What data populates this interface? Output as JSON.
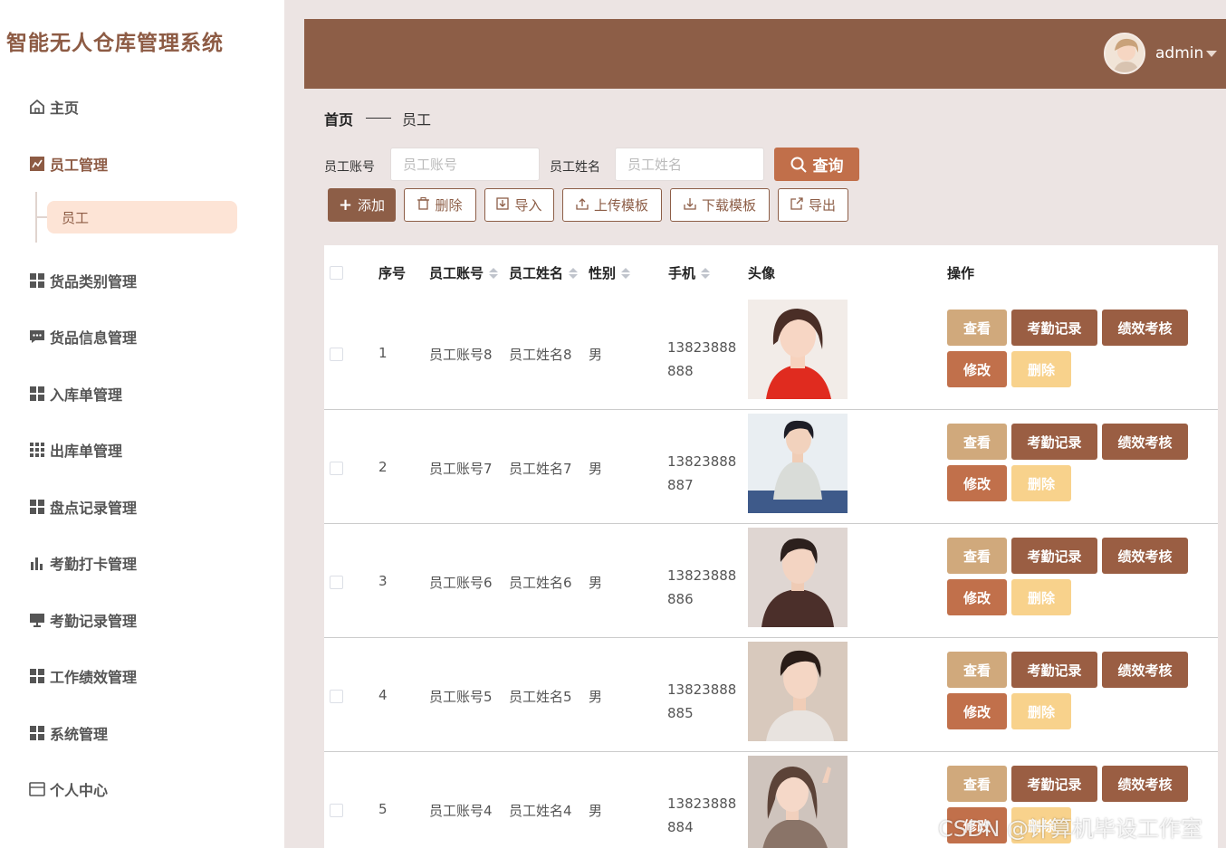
{
  "app": {
    "title": "智能无人仓库管理系统"
  },
  "sidebar": {
    "items": [
      {
        "label": "主页",
        "icon": "home-icon"
      },
      {
        "label": "员工管理",
        "icon": "chart-icon"
      },
      {
        "label": "货品类别管理",
        "icon": "grid-icon"
      },
      {
        "label": "货品信息管理",
        "icon": "message-icon"
      },
      {
        "label": "入库单管理",
        "icon": "grid-icon"
      },
      {
        "label": "出库单管理",
        "icon": "grid9-icon"
      },
      {
        "label": "盘点记录管理",
        "icon": "grid-icon"
      },
      {
        "label": "考勤打卡管理",
        "icon": "bar-chart-icon"
      },
      {
        "label": "考勤记录管理",
        "icon": "monitor-icon"
      },
      {
        "label": "工作绩效管理",
        "icon": "grid-icon"
      },
      {
        "label": "系统管理",
        "icon": "grid-icon"
      },
      {
        "label": "个人中心",
        "icon": "card-icon"
      }
    ],
    "sub_items": [
      {
        "label": "员工"
      }
    ]
  },
  "header": {
    "username": "admin"
  },
  "breadcrumb": {
    "home": "首页",
    "current": "员工"
  },
  "search": {
    "account_label": "员工账号",
    "account_placeholder": "员工账号",
    "name_label": "员工姓名",
    "name_placeholder": "员工姓名",
    "query_label": "查询"
  },
  "toolbar": {
    "add": "添加",
    "delete": "删除",
    "import": "导入",
    "upload_template": "上传模板",
    "download_template": "下载模板",
    "export": "导出"
  },
  "table": {
    "headers": {
      "index": "序号",
      "account": "员工账号",
      "name": "员工姓名",
      "gender": "性别",
      "phone": "手机",
      "avatar": "头像",
      "actions": "操作"
    },
    "rows": [
      {
        "index": "1",
        "account": "员工账号8",
        "name": "员工姓名8",
        "gender": "男",
        "phone": "13823888888"
      },
      {
        "index": "2",
        "account": "员工账号7",
        "name": "员工姓名7",
        "gender": "男",
        "phone": "13823888887"
      },
      {
        "index": "3",
        "account": "员工账号6",
        "name": "员工姓名6",
        "gender": "男",
        "phone": "13823888886"
      },
      {
        "index": "4",
        "account": "员工账号5",
        "name": "员工姓名5",
        "gender": "男",
        "phone": "13823888885"
      },
      {
        "index": "5",
        "account": "员工账号4",
        "name": "员工姓名4",
        "gender": "男",
        "phone": "13823888884"
      }
    ],
    "row_actions": {
      "view": "查看",
      "attendance": "考勤记录",
      "performance": "绩效考核",
      "edit": "修改",
      "delete": "删除"
    }
  },
  "watermark": "CSDN @计算机毕设工作室",
  "colors": {
    "brand": "#8d5e47",
    "accent": "#c16f4a",
    "submenu_bg": "#fde4d6",
    "view_btn": "#d0a97c",
    "delete_btn": "#f8d28c"
  }
}
